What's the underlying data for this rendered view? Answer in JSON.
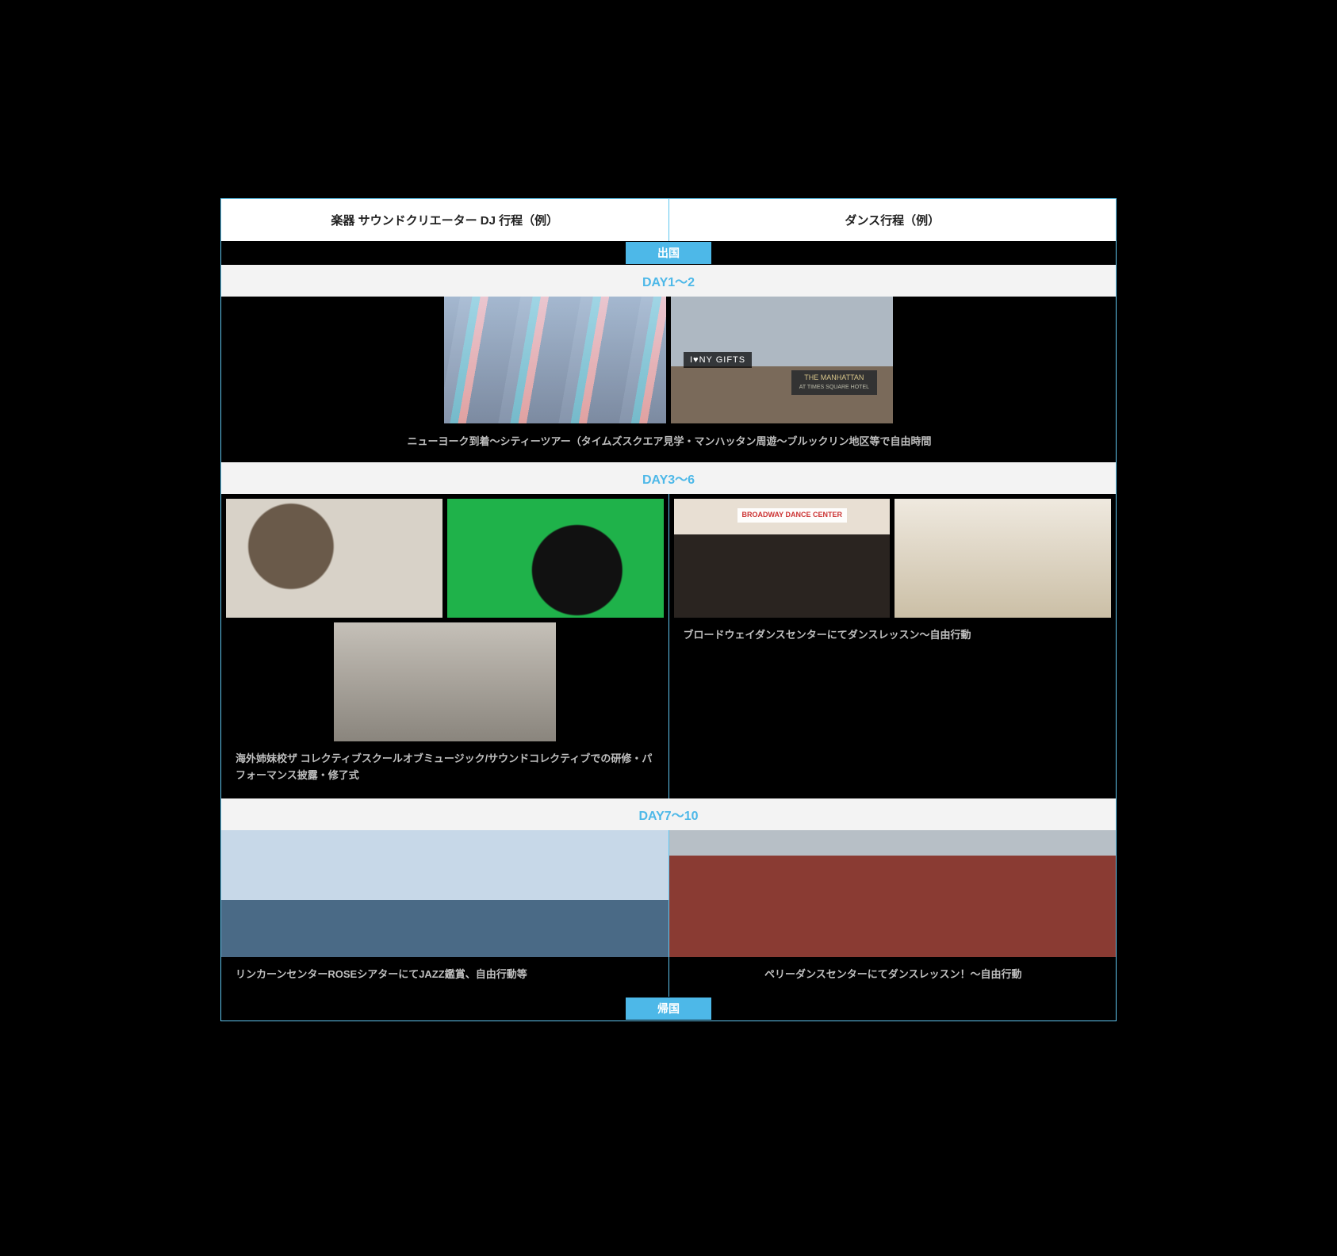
{
  "header": {
    "left": "楽器 サウンドクリエーター DJ 行程（例）",
    "right": "ダンス行程（例）"
  },
  "departure": "出国",
  "return": "帰国",
  "day1": {
    "label": "DAY1〜2",
    "caption": "ニューヨーク到着〜シティーツアー（タイムズスクエア見学・マンハッタン周遊〜ブルックリン地区等で自由時間",
    "sign_iny": "I♥NY GIFTS",
    "sign_hotel_line1": "THE MANHATTAN",
    "sign_hotel_line2": "AT TIMES SQUARE HOTEL"
  },
  "day3": {
    "label": "DAY3〜6",
    "left_caption": "海外姉妹校ザ コレクティブスクールオブミュージック/サウンドコレクティブでの研修・パフォーマンス披露・修了式",
    "right_caption": "ブロードウェイダンスセンターにてダンスレッスン〜自由行動",
    "bdc_sign": "BROADWAY DANCE CENTER"
  },
  "day7": {
    "label": "DAY7〜10",
    "left_caption": "リンカーンセンターROSEシアターにてJAZZ鑑賞、自由行動等",
    "right_caption": "ペリーダンスセンターにてダンスレッスン！〜自由行動"
  }
}
